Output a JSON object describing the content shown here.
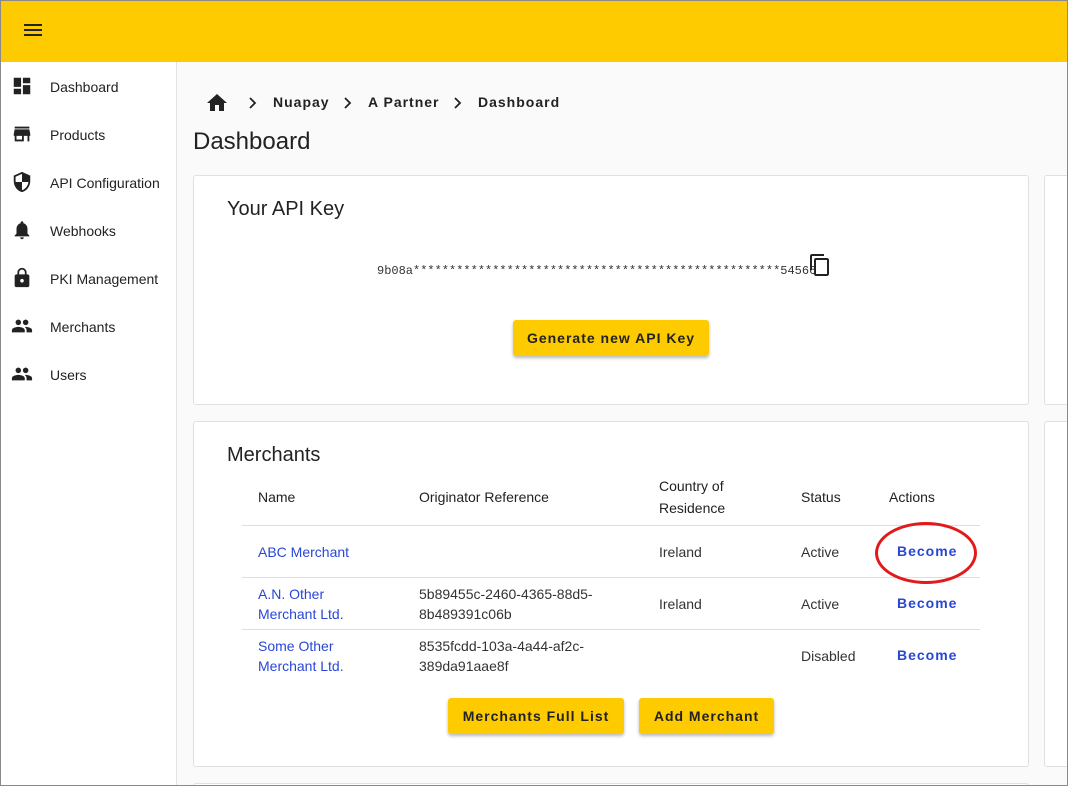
{
  "breadcrumb": {
    "items": [
      "Nuapay",
      "A Partner",
      "Dashboard"
    ]
  },
  "sidebar": {
    "items": [
      {
        "label": "Dashboard",
        "icon": "dashboard-icon"
      },
      {
        "label": "Products",
        "icon": "store-icon"
      },
      {
        "label": "API Configuration",
        "icon": "shield-icon"
      },
      {
        "label": "Webhooks",
        "icon": "bell-icon"
      },
      {
        "label": "PKI Management",
        "icon": "lock-icon"
      },
      {
        "label": "Merchants",
        "icon": "people-icon"
      },
      {
        "label": "Users",
        "icon": "people-icon"
      }
    ]
  },
  "page": {
    "title": "Dashboard"
  },
  "api_card": {
    "title": "Your API Key",
    "key": "9b08a***************************************************54566",
    "generate_label": "Generate new API Key"
  },
  "merchants_card": {
    "title": "Merchants",
    "headers": {
      "name": "Name",
      "originator": "Originator Reference",
      "country": "Country of Residence",
      "status": "Status",
      "actions": "Actions"
    },
    "rows": [
      {
        "name": "ABC Merchant",
        "originator": "",
        "country": "Ireland",
        "status": "Active",
        "action": "Become"
      },
      {
        "name": "A.N. Other Merchant Ltd.",
        "originator": "5b89455c-2460-4365-88d5-8b489391c06b",
        "country": "Ireland",
        "status": "Active",
        "action": "Become"
      },
      {
        "name": "Some Other Merchant Ltd.",
        "originator": "8535fcdd-103a-4a44-af2c-389da91aae8f",
        "country": "",
        "status": "Disabled",
        "action": "Become"
      }
    ],
    "full_list_label": "Merchants Full List",
    "add_label": "Add Merchant"
  },
  "colors": {
    "brand_yellow": "#fecb00",
    "link_blue": "#2947d6",
    "annotation_red": "#e11b1b"
  }
}
